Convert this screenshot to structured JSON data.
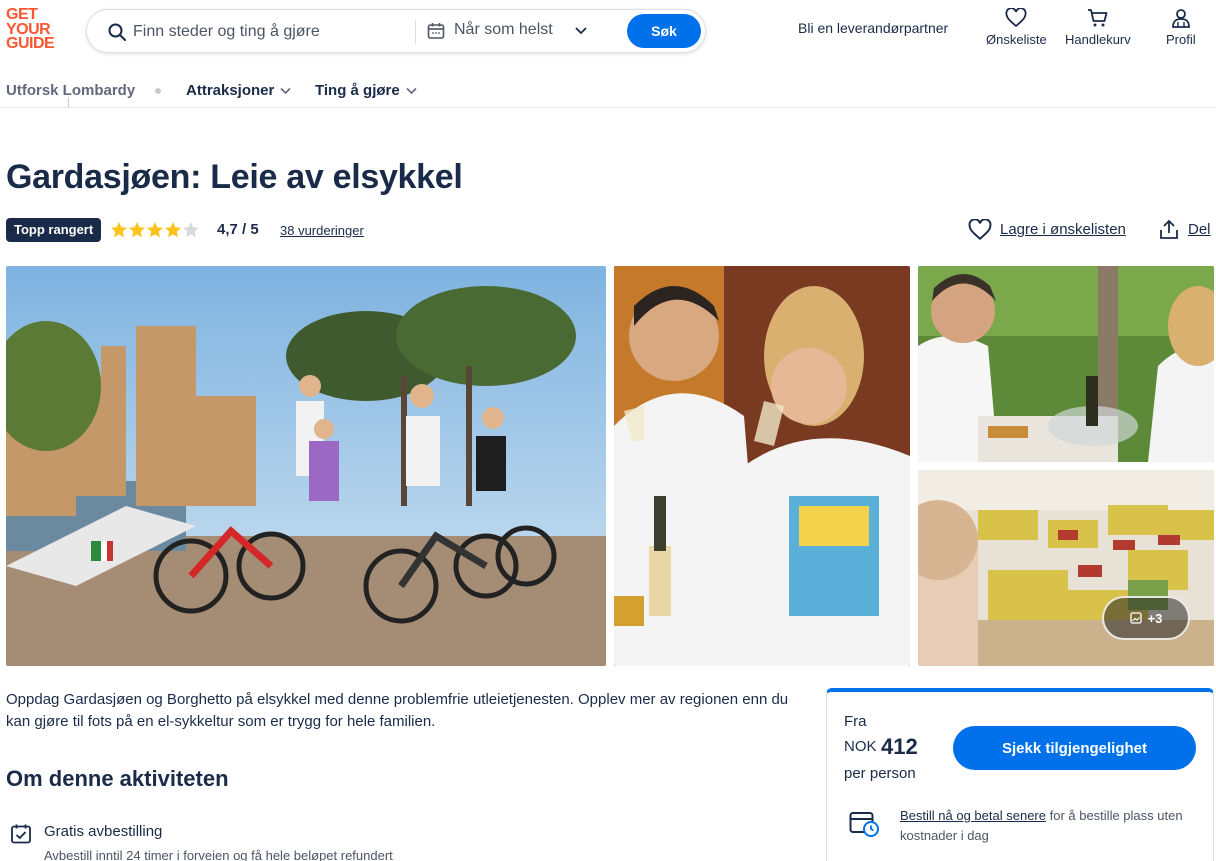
{
  "header": {
    "logo_lines": [
      "GET",
      "YOUR",
      "GUIDE"
    ],
    "search_placeholder": "Finn steder og ting å gjøre",
    "date_label": "Når som helst",
    "search_button": "Søk",
    "partner_link": "Bli en leverandørpartner",
    "wishlist": "Ønskeliste",
    "cart": "Handlekurv",
    "profile": "Profil"
  },
  "subnav": {
    "explore": "Utforsk Lombardy",
    "items": [
      "Attraksjoner",
      "Ting å gjøre"
    ]
  },
  "activity": {
    "title": "Gardasjøen: Leie av elsykkel",
    "badge": "Topp rangert",
    "rating": "4,7 / 5",
    "stars": 4.7,
    "reviews": "38 vurderinger",
    "save_wishlist": "Lagre i ønskelisten",
    "share": "Del",
    "more_photos": "+3",
    "description": "Oppdag Gardasjøen og Borghetto på elsykkel med denne problemfrie utleietjenesten. Opplev mer av regionen enn du kan gjøre til fots på en el-sykkeltur som er trygg for hele familien."
  },
  "about": {
    "title": "Om denne aktiviteten",
    "features": [
      {
        "title": "Gratis avbestilling",
        "desc": "Avbestill inntil 24 timer i forveien og få hele beløpet refundert",
        "icon": "calendar-check-icon"
      }
    ]
  },
  "booking": {
    "from": "Fra",
    "currency": "NOK",
    "price": "412",
    "per": "per person",
    "button": "Sjekk tilgjengelighet",
    "reserve_link": "Bestill nå og betal senere",
    "reserve_text": " for å bestille plass uten kostnader i dag"
  },
  "colors": {
    "brand": "#ff5533",
    "primary": "#0071eb",
    "navy": "#1a2b49",
    "star": "#ffc21a"
  }
}
